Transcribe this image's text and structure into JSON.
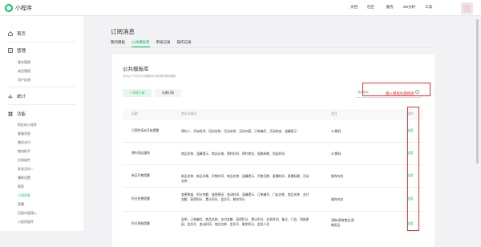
{
  "app": {
    "title": "小程序"
  },
  "topnav": {
    "items": [
      "文档",
      "社区 ·",
      "服务",
      "We分析",
      "工具 ·"
    ]
  },
  "sidebar": {
    "home": "首页",
    "manage": "管理",
    "manage_items": [
      "版本管理",
      "成员管理",
      "用户反馈"
    ],
    "stats": "统计",
    "features": "功能",
    "feature_items": [
      "附近的小程序",
      "客服消息",
      "微信支付",
      "物流助手",
      "交易组件",
      "发现活动 *",
      "爆款设置",
      "搜索",
      "订阅消息",
      "直播",
      "页面内容接入",
      "小程序插件"
    ]
  },
  "page": {
    "title": "订阅消息",
    "tabs": [
      "我的模板",
      "公共模板库",
      "审核记录",
      "操作记录"
    ]
  },
  "panel": {
    "title": "公共模板库",
    "desc": "你可从下方的公共模板库中选用所需的模板",
    "btn_primary": "一次性订阅",
    "btn_plain": "长期订阅",
    "search_placeholder": "搜索模板",
    "annotation": "输入模板标题搜索"
  },
  "table": {
    "headers": [
      "标题",
      "常见关键词",
      "类目",
      "操作"
    ],
    "rows": [
      {
        "title": "已预约培训开始提醒",
        "keywords": "预约人、开始时间、培训名称、活动名称、活动内容、订单编号、活动状态、温馨提示",
        "category": "3C数码",
        "op": "选用"
      },
      {
        "title": "预约到店通知",
        "keywords": "商品名称、温馨提示、商品价格、预约时间、预约地址、规格参数、到店时间",
        "category": "3C数码",
        "op": "选用"
      },
      {
        "title": "新品开售提醒",
        "keywords": "新品名称、新品详情、开售时间、商品名称、温馨提示、开售日期、直播时间、直播标题、活动名称",
        "category": "服饰内衣",
        "op": "选用"
      },
      {
        "title": "积分变更提醒",
        "keywords": "变更数量、积分余额、变更原因、变动时间、温馨提示、订单编号、门店名称、商品名称、支付金额、获得积分、累计积分、会员号、剩余积分",
        "category": "服饰内衣",
        "op": "选用"
      },
      {
        "title": "积分到账提醒",
        "keywords": "说明、订单编号、商品名称、支付金额、获得积分、累计积分、交易时间、备注、门店、到账原因、会员号、变动时间、商品名称、会员号、剩余积分、会员人员",
        "category": "宠物/宠物食品/宠物用品",
        "op": "选用"
      }
    ]
  },
  "colors": {
    "accent": "#07c160",
    "highlight": "#e0302e"
  }
}
